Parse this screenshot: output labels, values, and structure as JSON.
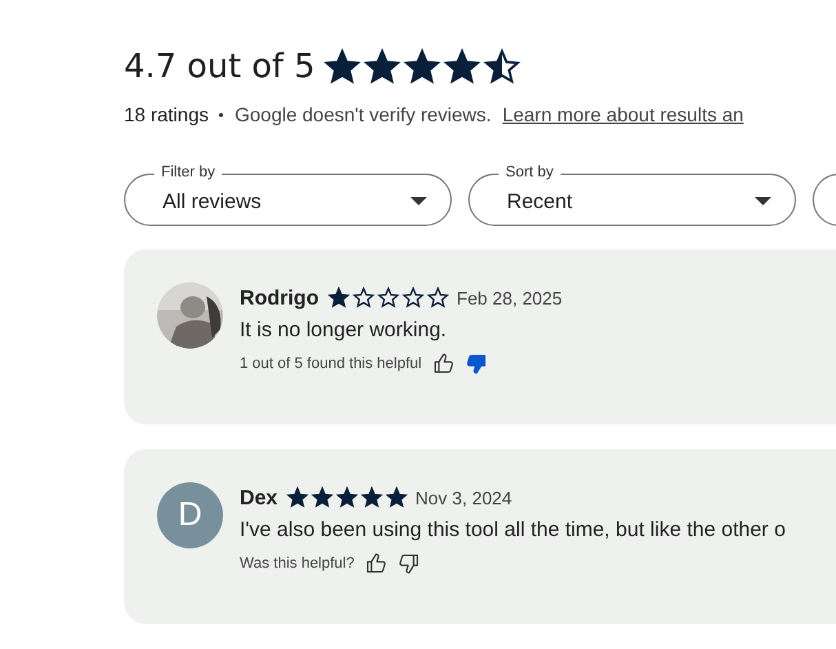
{
  "summary": {
    "title": "4.7 out of 5",
    "stars": 4.5,
    "count": "18 ratings",
    "notice": "Google doesn't verify reviews.",
    "link": "Learn more about results an"
  },
  "filters": [
    {
      "kind": "select",
      "label": "Filter by",
      "value": "All reviews"
    },
    {
      "kind": "select",
      "label": "Sort by",
      "value": "Recent"
    },
    {
      "kind": "cut"
    }
  ],
  "reviews": [
    {
      "author": "Rodrigo",
      "stars": 1,
      "date": "Feb 28, 2025",
      "text": "It is no longer working.",
      "helpful": "1 out of 5 found this helpful",
      "thumbs_up": false,
      "thumbs_down": true
    },
    {
      "author": "Dex",
      "avatar": {
        "kind": "letter",
        "initial": "D"
      },
      "stars": 5,
      "date": "Nov 3, 2024",
      "text": "I've also been using this tool all the time, but like the other o",
      "helpful": "Was this helpful?",
      "thumbs_up": false,
      "thumbs_down": false
    }
  ]
}
